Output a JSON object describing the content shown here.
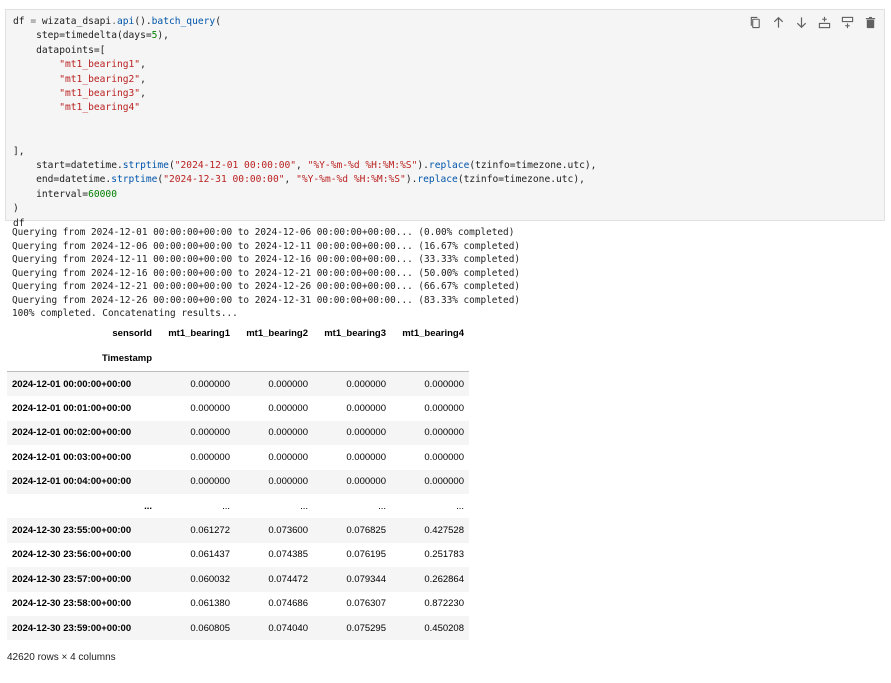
{
  "code_cell": {
    "lines": [
      [
        {
          "t": "df",
          "c": ""
        },
        {
          "t": " = ",
          "c": "op"
        },
        {
          "t": "wizata_dsapi",
          "c": ""
        },
        {
          "t": ".",
          "c": "op"
        },
        {
          "t": "api",
          "c": "fn"
        },
        {
          "t": "().",
          "c": ""
        },
        {
          "t": "batch_query",
          "c": "fn"
        },
        {
          "t": "(",
          "c": ""
        }
      ],
      [
        {
          "t": "    step=timedelta(days=",
          "c": ""
        },
        {
          "t": "5",
          "c": "num"
        },
        {
          "t": "),",
          "c": ""
        }
      ],
      [
        {
          "t": "    datapoints=[",
          "c": ""
        }
      ],
      [
        {
          "t": "        ",
          "c": ""
        },
        {
          "t": "\"mt1_bearing1\"",
          "c": "str"
        },
        {
          "t": ",",
          "c": ""
        }
      ],
      [
        {
          "t": "        ",
          "c": ""
        },
        {
          "t": "\"mt1_bearing2\"",
          "c": "str"
        },
        {
          "t": ",",
          "c": ""
        }
      ],
      [
        {
          "t": "        ",
          "c": ""
        },
        {
          "t": "\"mt1_bearing3\"",
          "c": "str"
        },
        {
          "t": ",",
          "c": ""
        }
      ],
      [
        {
          "t": "        ",
          "c": ""
        },
        {
          "t": "\"mt1_bearing4\"",
          "c": "str"
        }
      ],
      [
        {
          "t": "",
          "c": ""
        }
      ],
      [
        {
          "t": "",
          "c": ""
        }
      ],
      [
        {
          "t": "],",
          "c": ""
        }
      ],
      [
        {
          "t": "    start=datetime.",
          "c": ""
        },
        {
          "t": "strptime",
          "c": "fn"
        },
        {
          "t": "(",
          "c": ""
        },
        {
          "t": "\"2024-12-01 00:00:00\"",
          "c": "str"
        },
        {
          "t": ", ",
          "c": ""
        },
        {
          "t": "\"%Y-%m-%d %H:%M:%S\"",
          "c": "str"
        },
        {
          "t": ").",
          "c": ""
        },
        {
          "t": "replace",
          "c": "fn"
        },
        {
          "t": "(tzinfo=timezone.utc),",
          "c": ""
        }
      ],
      [
        {
          "t": "    end=datetime.",
          "c": ""
        },
        {
          "t": "strptime",
          "c": "fn"
        },
        {
          "t": "(",
          "c": ""
        },
        {
          "t": "\"2024-12-31 00:00:00\"",
          "c": "str"
        },
        {
          "t": ", ",
          "c": ""
        },
        {
          "t": "\"%Y-%m-%d %H:%M:%S\"",
          "c": "str"
        },
        {
          "t": ").",
          "c": ""
        },
        {
          "t": "replace",
          "c": "fn"
        },
        {
          "t": "(tzinfo=timezone.utc),",
          "c": ""
        }
      ],
      [
        {
          "t": "    interval=",
          "c": ""
        },
        {
          "t": "60000",
          "c": "num"
        }
      ],
      [
        {
          "t": ")",
          "c": ""
        }
      ],
      [
        {
          "t": "df",
          "c": ""
        }
      ]
    ]
  },
  "toolbar": {
    "buttons": [
      {
        "icon": "copy-icon"
      },
      {
        "icon": "arrow-up-icon"
      },
      {
        "icon": "arrow-down-icon"
      },
      {
        "icon": "insert-above-icon"
      },
      {
        "icon": "insert-below-icon"
      },
      {
        "icon": "trash-icon"
      }
    ]
  },
  "stream_output": [
    "Querying from 2024-12-01 00:00:00+00:00 to 2024-12-06 00:00:00+00:00... (0.00% completed)",
    "Querying from 2024-12-06 00:00:00+00:00 to 2024-12-11 00:00:00+00:00... (16.67% completed)",
    "Querying from 2024-12-11 00:00:00+00:00 to 2024-12-16 00:00:00+00:00... (33.33% completed)",
    "Querying from 2024-12-16 00:00:00+00:00 to 2024-12-21 00:00:00+00:00... (50.00% completed)",
    "Querying from 2024-12-21 00:00:00+00:00 to 2024-12-26 00:00:00+00:00... (66.67% completed)",
    "Querying from 2024-12-26 00:00:00+00:00 to 2024-12-31 00:00:00+00:00... (83.33% completed)",
    "100% completed. Concatenating results..."
  ],
  "dataframe": {
    "columns_name": "sensorId",
    "index_name": "Timestamp",
    "columns": [
      "mt1_bearing1",
      "mt1_bearing2",
      "mt1_bearing3",
      "mt1_bearing4"
    ],
    "rows": [
      {
        "index": "2024-12-01 00:00:00+00:00",
        "values": [
          "0.000000",
          "0.000000",
          "0.000000",
          "0.000000"
        ]
      },
      {
        "index": "2024-12-01 00:01:00+00:00",
        "values": [
          "0.000000",
          "0.000000",
          "0.000000",
          "0.000000"
        ]
      },
      {
        "index": "2024-12-01 00:02:00+00:00",
        "values": [
          "0.000000",
          "0.000000",
          "0.000000",
          "0.000000"
        ]
      },
      {
        "index": "2024-12-01 00:03:00+00:00",
        "values": [
          "0.000000",
          "0.000000",
          "0.000000",
          "0.000000"
        ]
      },
      {
        "index": "2024-12-01 00:04:00+00:00",
        "values": [
          "0.000000",
          "0.000000",
          "0.000000",
          "0.000000"
        ]
      },
      {
        "index": "...",
        "values": [
          "...",
          "...",
          "...",
          "..."
        ]
      },
      {
        "index": "2024-12-30 23:55:00+00:00",
        "values": [
          "0.061272",
          "0.073600",
          "0.076825",
          "0.427528"
        ]
      },
      {
        "index": "2024-12-30 23:56:00+00:00",
        "values": [
          "0.061437",
          "0.074385",
          "0.076195",
          "0.251783"
        ]
      },
      {
        "index": "2024-12-30 23:57:00+00:00",
        "values": [
          "0.060032",
          "0.074472",
          "0.079344",
          "0.262864"
        ]
      },
      {
        "index": "2024-12-30 23:58:00+00:00",
        "values": [
          "0.061380",
          "0.074686",
          "0.076307",
          "0.872230"
        ]
      },
      {
        "index": "2024-12-30 23:59:00+00:00",
        "values": [
          "0.060805",
          "0.074040",
          "0.075295",
          "0.450208"
        ]
      }
    ],
    "shape_text": "42620 rows × 4 columns"
  }
}
